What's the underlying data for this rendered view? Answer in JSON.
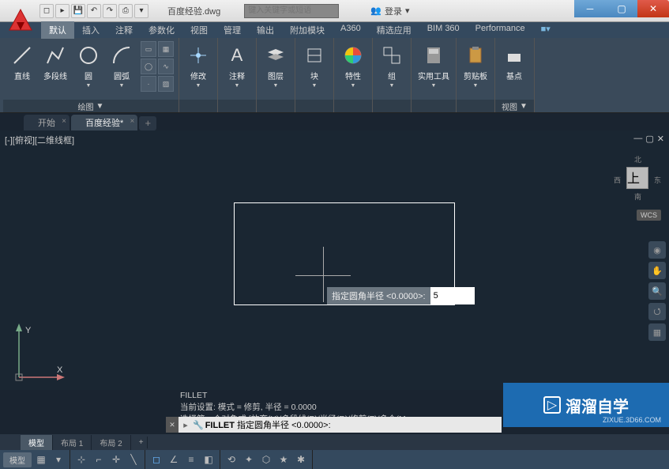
{
  "titlebar": {
    "doc_name": "百度经验.dwg",
    "search_placeholder": "键入关键字或短语",
    "login_label": "登录"
  },
  "menubar": {
    "tabs": [
      "默认",
      "插入",
      "注释",
      "参数化",
      "视图",
      "管理",
      "输出",
      "附加模块",
      "A360",
      "精选应用",
      "BIM 360",
      "Performance"
    ],
    "active": 0
  },
  "ribbon": {
    "draw_panel": {
      "line": "直线",
      "polyline": "多段线",
      "circle": "圆",
      "arc": "圆弧",
      "label": "绘图"
    },
    "modify": "修改",
    "annotate": "注释",
    "layer": "图层",
    "block": "块",
    "properties": "特性",
    "group": "组",
    "utilities": "实用工具",
    "clipboard": "剪贴板",
    "base": "基点",
    "view": "视图"
  },
  "filetabs": {
    "start": "开始",
    "doc": "百度经验*"
  },
  "viewport": {
    "label": "[-][俯视][二维线框]",
    "wcs": "WCS",
    "compass": {
      "n": "北",
      "s": "南",
      "e": "东",
      "w": "西"
    },
    "prompt_label": "指定圆角半径 <0.0000>:",
    "prompt_value": "5",
    "ucs": {
      "x": "X",
      "y": "Y"
    }
  },
  "command": {
    "history_1": "FILLET",
    "history_2": "当前设置: 模式 = 修剪, 半径 = 0.0000",
    "history_3": "选择第一个对象或 [放弃(U)/多段线(P)/半径(R)/修剪(T)/多个(M",
    "line_cmd": "FILLET",
    "line_rest": " 指定圆角半径 <0.0000>:"
  },
  "layouts": {
    "model": "模型",
    "l1": "布局 1",
    "l2": "布局 2"
  },
  "status": {
    "model": "模型"
  },
  "watermark": {
    "text": "溜溜自学",
    "url": "ZIXUE.3D66.COM"
  }
}
